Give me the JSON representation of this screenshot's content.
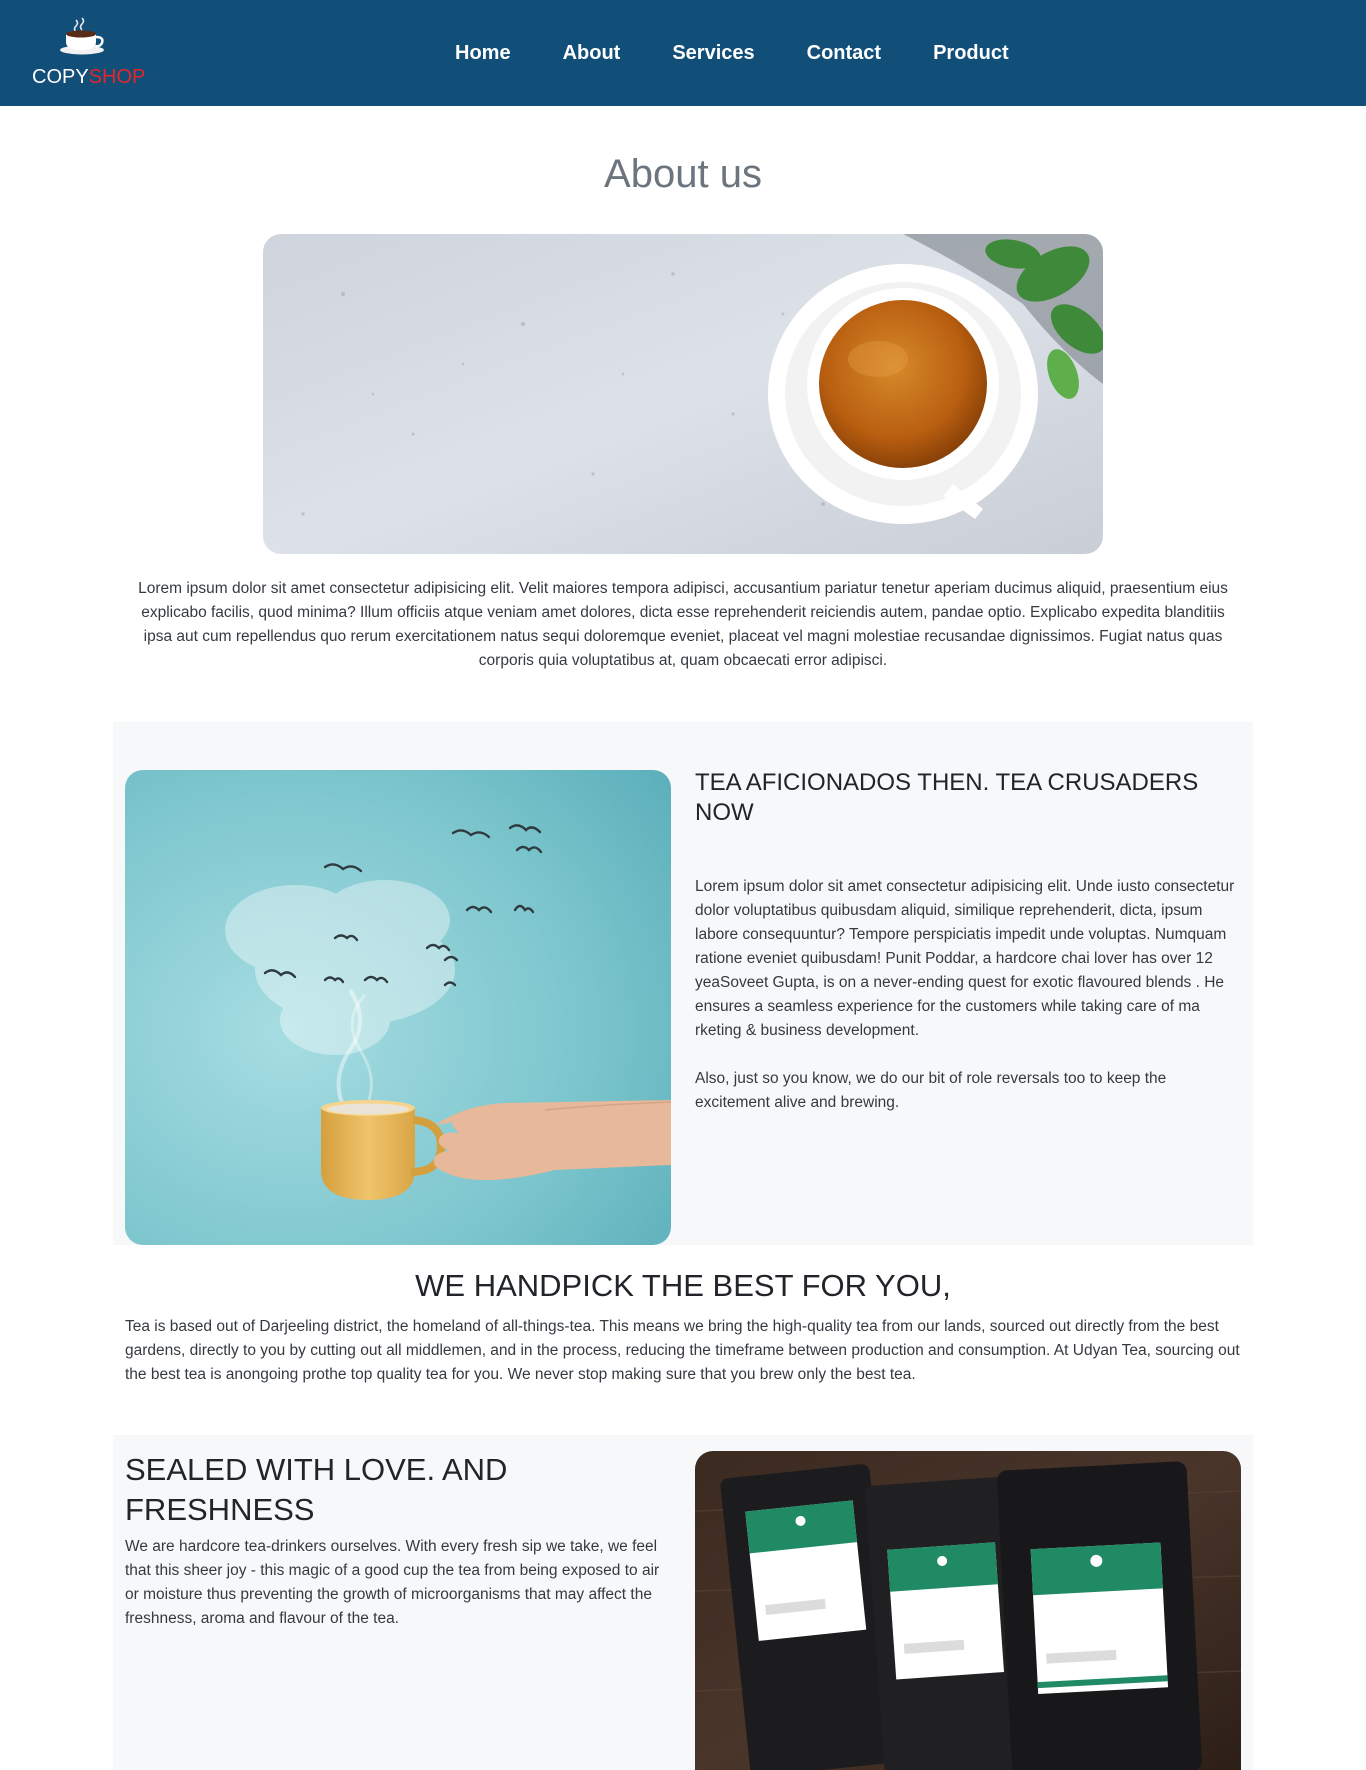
{
  "brand": {
    "part1": "COPY",
    "part2": "SHOP"
  },
  "nav": {
    "items": [
      "Home",
      "About",
      "Services",
      "Contact",
      "Product"
    ]
  },
  "about": {
    "title": "About us",
    "text": "Lorem ipsum dolor sit amet consectetur adipisicing elit. Velit maiores tempora adipisci, accusantium pariatur tenetur aperiam ducimus aliquid, praesentium eius explicabo facilis, quod minima? Illum officiis atque veniam amet dolores, dicta esse reprehenderit reiciendis autem, pandae optio. Explicabo expedita blanditiis ipsa aut cum repellendus quo rerum exercitationem natus sequi doloremque eveniet, placeat vel magni molestiae recusandae dignissimos. Fugiat natus quas corporis quia voluptatibus at, quam obcaecati error adipisci."
  },
  "section1": {
    "title": "TEA AFICIONADOS THEN. TEA CRUSADERS NOW",
    "paragraph1": "Lorem ipsum dolor sit amet consectetur adipisicing elit. Unde iusto consectetur dolor voluptatibus quibusdam aliquid, similique reprehenderit, dicta, ipsum labore consequuntur? Tempore perspiciatis impedit unde voluptas. Numquam ratione eveniet quibusdam! Punit Poddar, a hardcore chai lover has over 12 yeaSoveet Gupta, is on a never-ending quest for exotic flavoured blends . He ensures a seamless experience for the customers while taking care of ma rketing & business development.",
    "paragraph2": "Also, just so you know, we do our bit of role reversals too to keep the excitement alive and brewing."
  },
  "handpick": {
    "title": "WE HANDPICK THE BEST FOR YOU,",
    "text": "Tea is based out of Darjeeling district, the homeland of all-things-tea. This means we bring the high-quality tea from our lands, sourced out directly from the best gardens, directly to you by cutting out all middlemen, and in the process, reducing the timeframe between production and consumption. At Udyan Tea, sourcing out the best tea is anongoing prothe top quality tea for you. We never stop making sure that you brew only the best tea."
  },
  "section2": {
    "title": "SEALED WITH LOVE. AND FRESHNESS",
    "text": "We are hardcore tea-drinkers ourselves. With every fresh sip we take, we feel that this sheer joy - this magic of a good cup the tea from being exposed to air or moisture thus preventing the growth of microorganisms that may affect the freshness, aroma and flavour of the tea."
  },
  "colors": {
    "navbar": "#114e78",
    "brand_accent": "#e3262a",
    "section_bg": "#f7f8fa",
    "heading_muted": "#6c757d"
  }
}
